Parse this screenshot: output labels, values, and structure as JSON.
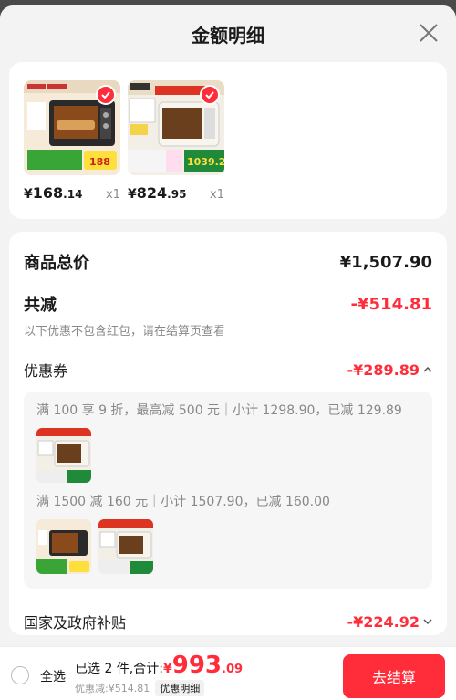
{
  "header": {
    "title": "金额明细"
  },
  "products": [
    {
      "price_symbol": "¥",
      "price_int": "168",
      "price_dec": ".14",
      "qty": "x1",
      "promo_text": "188"
    },
    {
      "price_symbol": "¥",
      "price_int": "824",
      "price_dec": ".95",
      "qty": "x1",
      "promo_text": "1039.2"
    }
  ],
  "summary": {
    "total_label": "商品总价",
    "total_value": "¥1,507.90",
    "reduce_label": "共减",
    "reduce_value": "-¥514.81",
    "hint": "以下优惠不包含红包，请在结算页查看",
    "coupon_label": "优惠券",
    "coupon_value": "-¥289.89",
    "coupon_rules": [
      {
        "text": "满 100 享 9 折，最高减 500 元｜小计 1298.90，已减 129.89"
      },
      {
        "text": "满 1500 减 160 元｜小计 1507.90，已减 160.00"
      }
    ],
    "subsidy_label": "国家及政府补贴",
    "subsidy_value": "-¥224.92"
  },
  "bottom": {
    "select_all": "全选",
    "selected_text": "已选 2 件,合计:",
    "total_symbol": "¥",
    "total_int": "993",
    "total_dec": ".09",
    "discount_text": "优惠减:¥514.81",
    "detail_tag": "优惠明细",
    "checkout": "去结算"
  },
  "colors": {
    "accent": "#ff2d3a",
    "background": "#f3f3f3"
  }
}
